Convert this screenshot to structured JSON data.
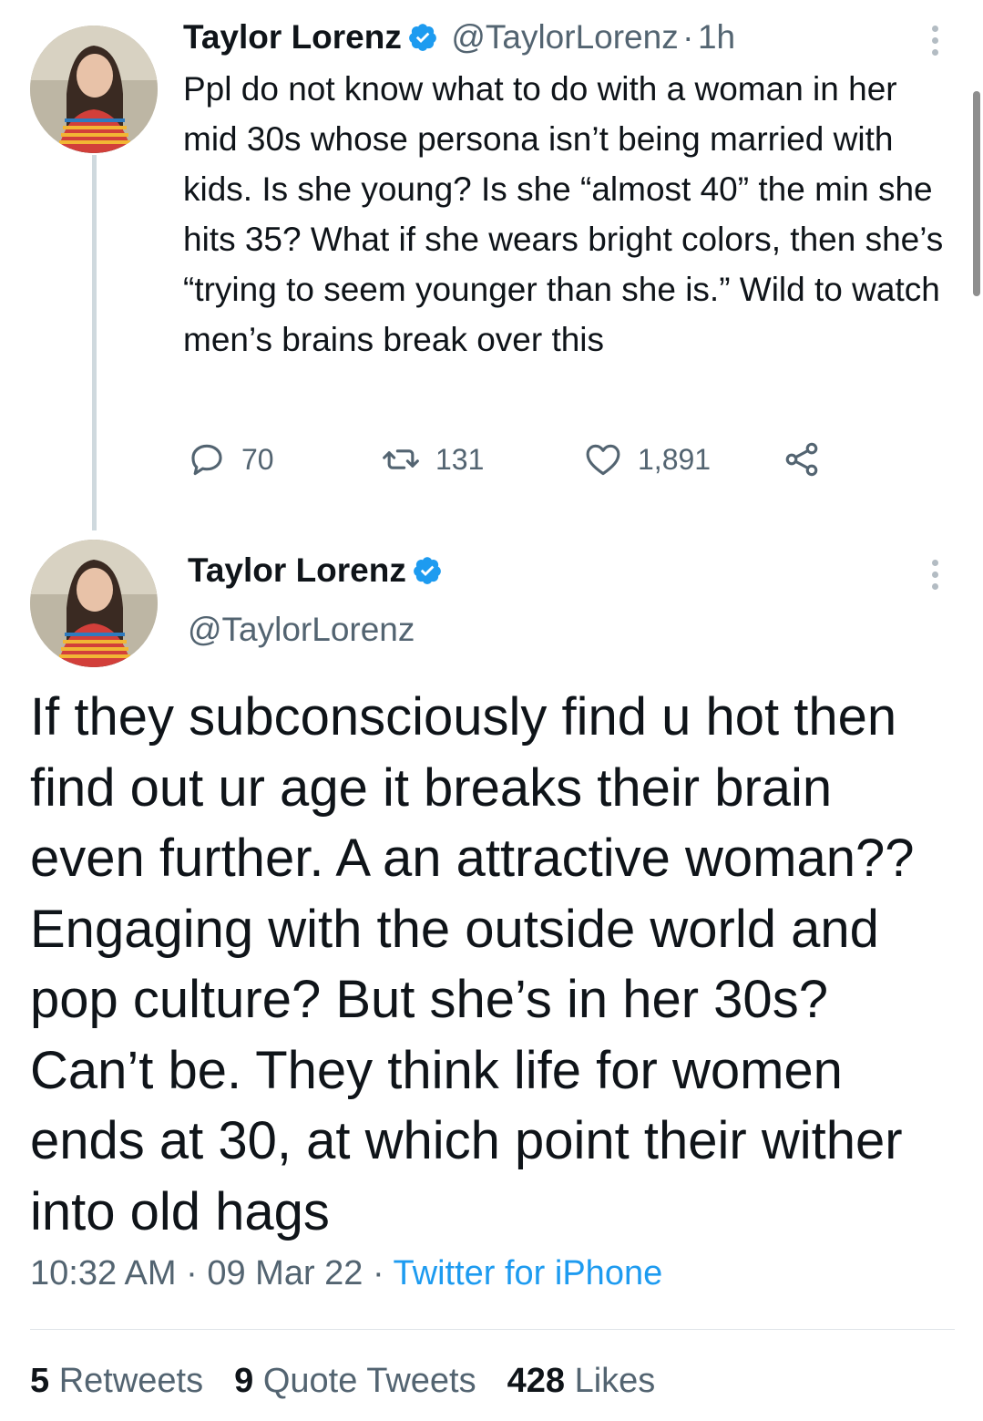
{
  "colors": {
    "text": "#0f1419",
    "secondary": "#536471",
    "accent": "#1d9bf0",
    "thread_line": "#cfd9de"
  },
  "tweet1": {
    "name": "Taylor Lorenz",
    "handle": "@TaylorLorenz",
    "separator": "·",
    "time": "1h",
    "text": "Ppl do not know what to do with a woman in her mid 30s whose persona isn’t being married with kids. Is she young? Is she “almost 40” the min she hits 35? What if she wears bright colors, then she’s “trying to seem younger than she is.” Wild to watch men’s brains break over this",
    "replies": "70",
    "retweets": "131",
    "likes": "1,891",
    "icons": [
      "reply-icon",
      "retweet-icon",
      "like-icon",
      "share-icon",
      "verified-icon",
      "more-icon"
    ]
  },
  "tweet2": {
    "name": "Taylor Lorenz",
    "handle": "@TaylorLorenz",
    "text": "If they subconsciously find u hot then find out ur age it breaks their brain even further. A an attractive woman?? Engaging with the outside world and pop culture? But she’s in her 30s? Can’t be. They think life for women ends at 30, at which point their wither into old hags",
    "time": "10:32 AM",
    "sep1": "·",
    "date": "09 Mar 22",
    "sep2": "·",
    "source": "Twitter for iPhone",
    "stats": {
      "retweets_count": "5",
      "retweets_label": "Retweets",
      "quotes_count": "9",
      "quotes_label": "Quote Tweets",
      "likes_count": "428",
      "likes_label": "Likes"
    }
  }
}
